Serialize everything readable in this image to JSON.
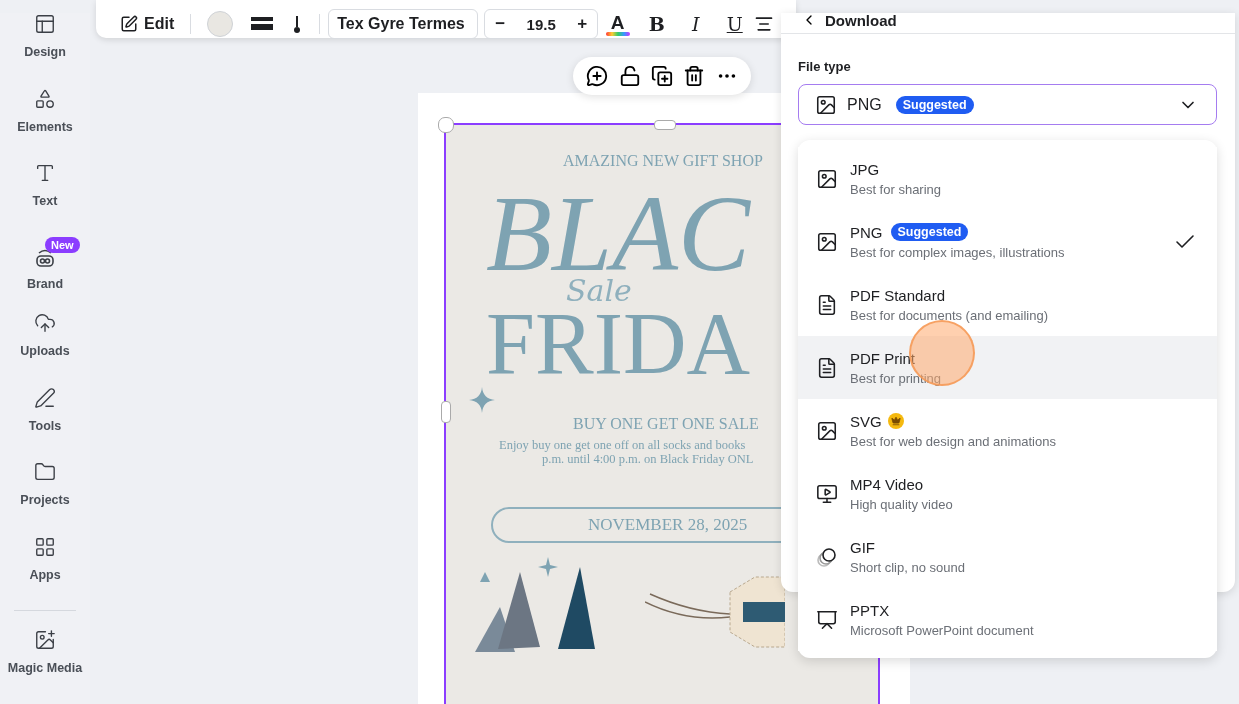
{
  "sidebar": {
    "items": [
      {
        "label": "Design"
      },
      {
        "label": "Elements"
      },
      {
        "label": "Text"
      },
      {
        "label": "Brand",
        "badge": "New"
      },
      {
        "label": "Uploads"
      },
      {
        "label": "Tools"
      },
      {
        "label": "Projects"
      },
      {
        "label": "Apps"
      }
    ],
    "extra_items": [
      {
        "label": "Magic Media"
      }
    ]
  },
  "toolbar": {
    "edit_label": "Edit",
    "font": "Tex Gyre Termes",
    "decrease": "−",
    "size": "19.5",
    "increase": "+",
    "text_color_glyph": "A",
    "format_glyphs": [
      "B",
      "I",
      "U"
    ]
  },
  "poster": {
    "kicker": "AMAZING NEW GIFT SHOP",
    "headline_1": "BLAC",
    "headline_2": "FRIDA",
    "script": "Sale",
    "offer_title": "BUY ONE GET ONE SALE",
    "offer_lines": [
      "Enjoy buy one get one off on all socks and books",
      "p.m. until 4:00 p.m. on Black Friday ONL"
    ],
    "date": "NOVEMBER 28, 2025"
  },
  "download_panel": {
    "title": "Download",
    "file_type_label": "File type",
    "select": {
      "value": "PNG",
      "badge": "Suggested"
    },
    "options": [
      {
        "kind": "image",
        "name": "JPG",
        "description": "Best for sharing",
        "selected": false,
        "hovered": false
      },
      {
        "kind": "image",
        "name": "PNG",
        "badge": "Suggested",
        "description": "Best for complex images, illustrations",
        "selected": true,
        "hovered": false
      },
      {
        "kind": "document",
        "name": "PDF Standard",
        "description": "Best for documents (and emailing)",
        "selected": false,
        "hovered": false
      },
      {
        "kind": "document",
        "name": "PDF Print",
        "description": "Best for printing",
        "selected": false,
        "hovered": true
      },
      {
        "kind": "image",
        "name": "SVG",
        "premium": true,
        "description": "Best for web design and animations",
        "selected": false,
        "hovered": false
      },
      {
        "kind": "video",
        "name": "MP4 Video",
        "description": "High quality video",
        "selected": false,
        "hovered": false
      },
      {
        "kind": "animation",
        "name": "GIF",
        "description": "Short clip, no sound",
        "selected": false,
        "hovered": false
      },
      {
        "kind": "presentation",
        "name": "PPTX",
        "description": "Microsoft PowerPoint document",
        "selected": false,
        "hovered": false
      }
    ]
  }
}
